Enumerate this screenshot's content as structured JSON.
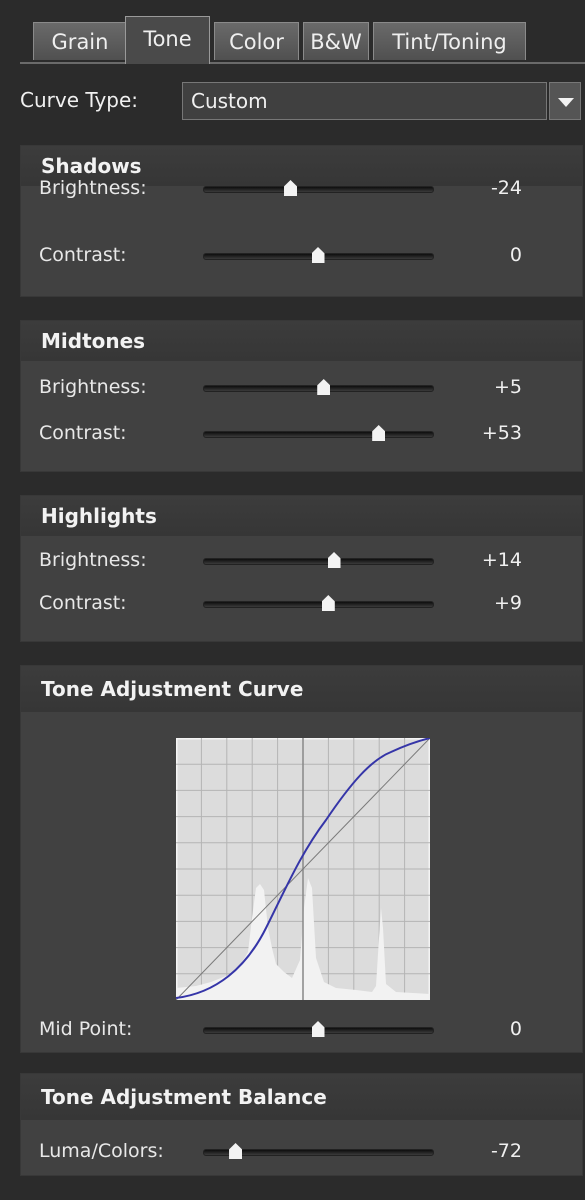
{
  "tabs": [
    {
      "label": "Grain",
      "active": false
    },
    {
      "label": "Tone",
      "active": true
    },
    {
      "label": "Color",
      "active": false
    },
    {
      "label": "B&W",
      "active": false
    },
    {
      "label": "Tint/Toning",
      "active": false
    }
  ],
  "curve_type": {
    "label": "Curve Type:",
    "value": "Custom",
    "dropdown_icon": "triangle-down"
  },
  "shadows": {
    "title": "Shadows",
    "brightness": {
      "label": "Brightness:",
      "value": "-24",
      "position": 0.38
    },
    "contrast": {
      "label": "Contrast:",
      "value": "0",
      "position": 0.5
    }
  },
  "midtones": {
    "title": "Midtones",
    "brightness": {
      "label": "Brightness:",
      "value": "+5",
      "position": 0.525
    },
    "contrast": {
      "label": "Contrast:",
      "value": "+53",
      "position": 0.765
    }
  },
  "highlights": {
    "title": "Highlights",
    "brightness": {
      "label": "Brightness:",
      "value": "+14",
      "position": 0.57
    },
    "contrast": {
      "label": "Contrast:",
      "value": "+9",
      "position": 0.545
    }
  },
  "tone_curve": {
    "title": "Tone Adjustment Curve",
    "mid_point": {
      "label": "Mid Point:",
      "value": "0",
      "position": 0.5
    },
    "colors": {
      "background": "#dcdcdc",
      "grid": "#b4b4b4",
      "curve": "#3535a8",
      "diagonal": "#7a7a7a",
      "histogram": "#f2f2f2"
    }
  },
  "balance": {
    "title": "Tone Adjustment Balance",
    "luma_colors": {
      "label": "Luma/Colors:",
      "value": "-72",
      "position": 0.14
    }
  },
  "colors": {
    "panel": "#414141",
    "header": "#383838",
    "text": "#f0f0f0"
  }
}
